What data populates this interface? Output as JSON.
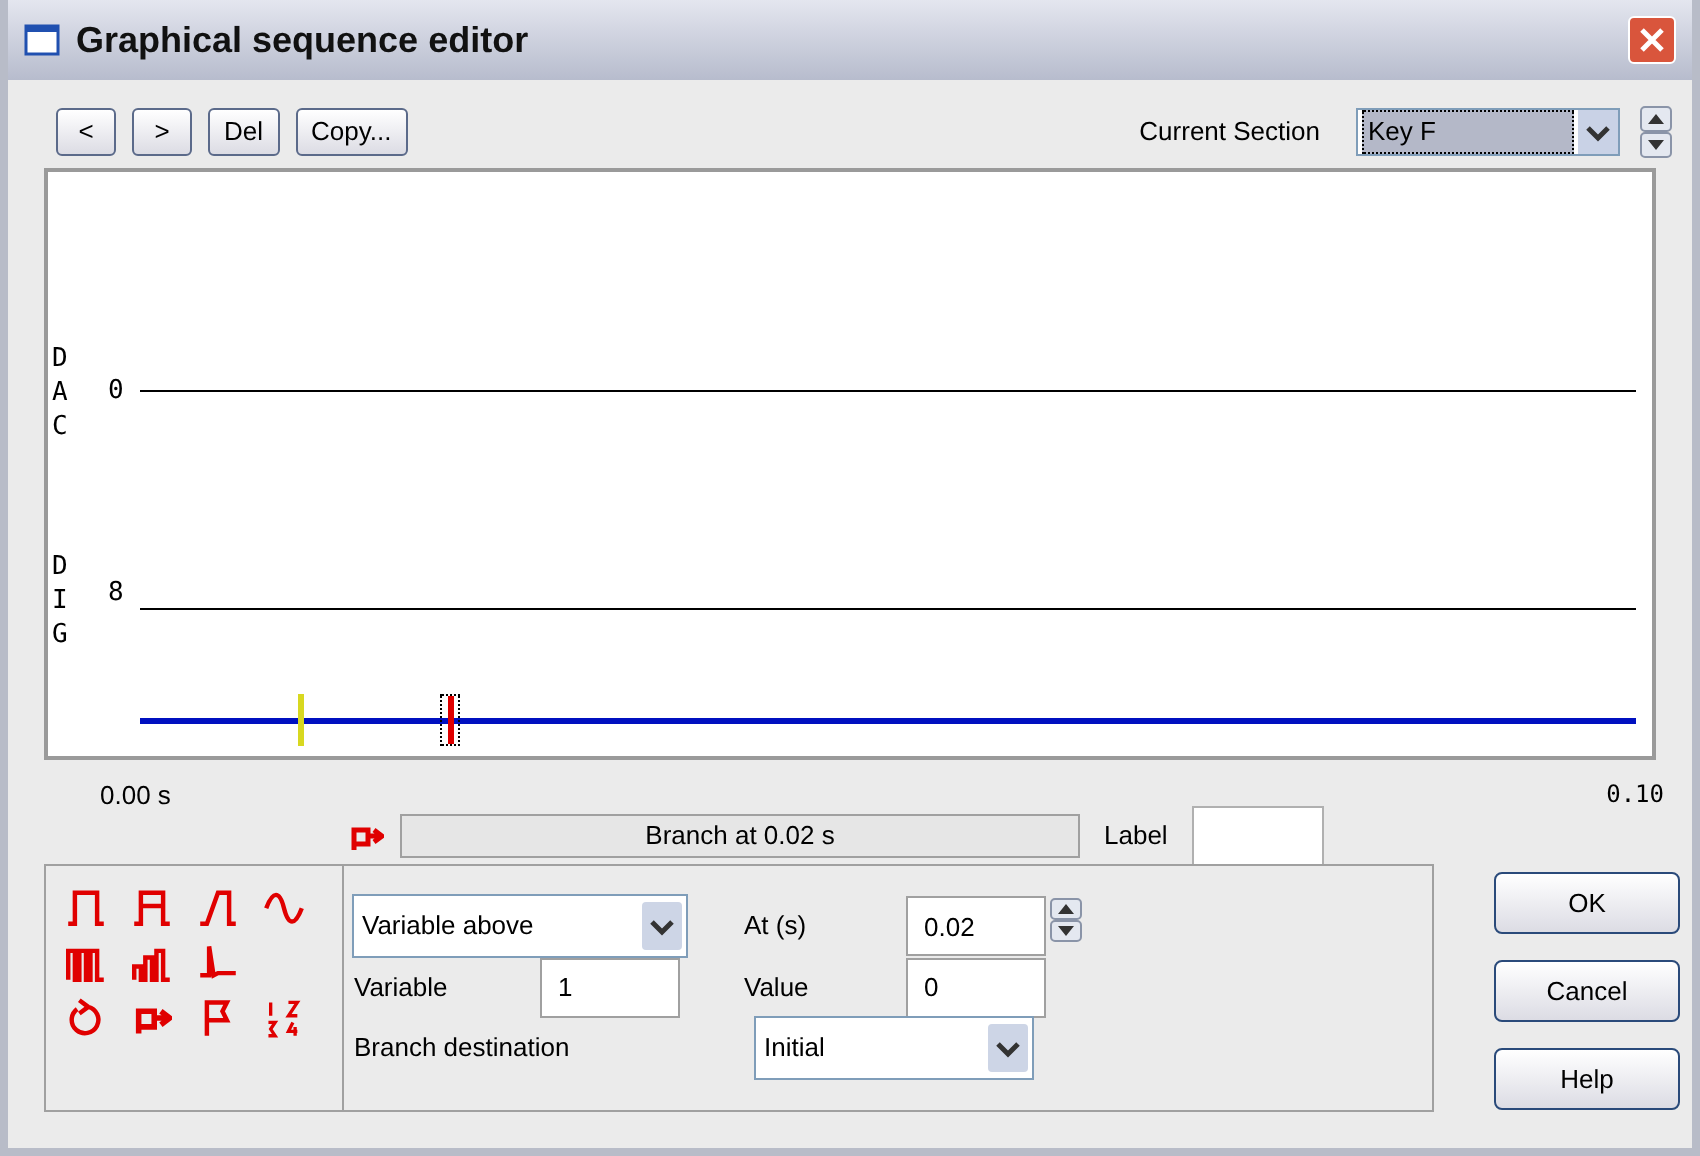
{
  "window": {
    "title": "Graphical sequence editor"
  },
  "toolbar": {
    "buttons": [
      "<",
      ">",
      "Del",
      "Copy..."
    ]
  },
  "section": {
    "label": "Current Section",
    "value": "Key F"
  },
  "traces": [
    {
      "kind": "analog",
      "label": "DAC",
      "value": "0"
    },
    {
      "kind": "digital",
      "label": "DIG",
      "value": "8"
    }
  ],
  "markers": [
    {
      "color": "#d8d820",
      "selected": false
    },
    {
      "color": "#e00000",
      "selected": true
    }
  ],
  "time_axis": {
    "start": "0.00 s",
    "end": "0.10"
  },
  "step": {
    "description": "Branch at 0.02 s",
    "label": "Label"
  },
  "params": {
    "type": "Variable above",
    "at": {
      "label": "At (s)",
      "value": "0.02"
    },
    "variable": {
      "label": "Variable",
      "value": "1"
    },
    "value": {
      "label": "Value",
      "value": "0"
    },
    "destination": {
      "label": "Branch destination",
      "value": "Initial"
    }
  },
  "buttons": [
    "OK",
    "Cancel",
    "Help"
  ]
}
